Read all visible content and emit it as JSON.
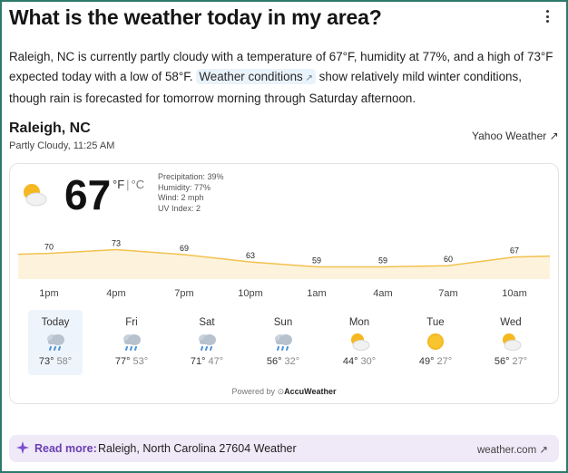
{
  "title": "What is the weather today in my area?",
  "summary": {
    "before": "Raleigh, NC is currently partly cloudy with a temperature of 67°F, humidity at 77%, and a high of 73°F expected today with a low of 58°F.",
    "chip": "Weather conditions",
    "after": "show relatively mild winter conditions, though rain is forecasted for tomorrow morning through Saturday afternoon."
  },
  "location": "Raleigh, NC",
  "condition": "Partly Cloudy, 11:25 AM",
  "source_link": "Yahoo Weather",
  "current": {
    "temp": "67",
    "unit_f": "°F",
    "unit_sep": "|",
    "unit_c": "°C",
    "icon": "partly-cloudy-icon",
    "precipitation": "Precipitation: 39%",
    "humidity": "Humidity: 77%",
    "wind": "Wind: 2 mph",
    "uv": "UV Index: 2"
  },
  "hourly": {
    "labels": [
      "1pm",
      "4pm",
      "7pm",
      "10pm",
      "1am",
      "4am",
      "7am",
      "10am"
    ],
    "temps": [
      70,
      73,
      69,
      63,
      59,
      59,
      60,
      67
    ],
    "line_color": "#f2c14e",
    "fill_color": "#fdf3dc"
  },
  "daily": [
    {
      "day": "Today",
      "high": "73°",
      "low": "58°",
      "icon": "rain-icon",
      "selected": true
    },
    {
      "day": "Fri",
      "high": "77°",
      "low": "53°",
      "icon": "rain-icon"
    },
    {
      "day": "Sat",
      "high": "71°",
      "low": "47°",
      "icon": "rain-icon"
    },
    {
      "day": "Sun",
      "high": "56°",
      "low": "32°",
      "icon": "rain-icon"
    },
    {
      "day": "Mon",
      "high": "44°",
      "low": "30°",
      "icon": "partly-cloudy-icon"
    },
    {
      "day": "Tue",
      "high": "49°",
      "low": "27°",
      "icon": "sun-icon"
    },
    {
      "day": "Wed",
      "high": "56°",
      "low": "27°",
      "icon": "partly-cloudy-icon"
    }
  ],
  "powered": {
    "prefix": "Powered by",
    "brand": "AccuWeather"
  },
  "read_more": {
    "label": "Read more:",
    "text": "Raleigh, North Carolina 27604 Weather",
    "source": "weather.com"
  },
  "colors": {
    "accent": "#6a3fb3",
    "frame": "#2d7a6b",
    "rain": "#6aa9dc",
    "sun": "#f5b820"
  }
}
